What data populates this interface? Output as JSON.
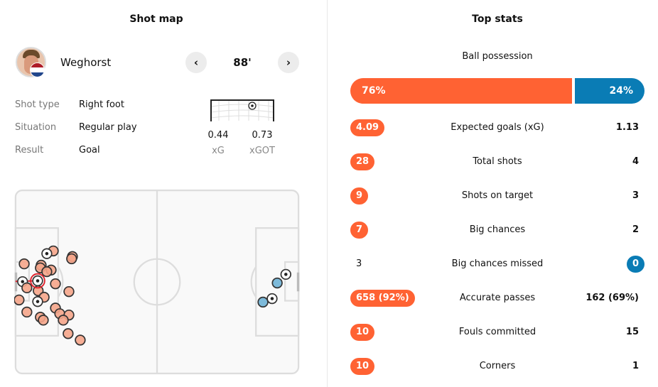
{
  "shot_map": {
    "title": "Shot map",
    "player": {
      "name": "Weghorst",
      "flag": [
        "#ae1c28",
        "#ffffff",
        "#21468b"
      ]
    },
    "minute": "88'",
    "prev_icon": "chevron-left-icon",
    "next_icon": "chevron-right-icon",
    "details": [
      {
        "label": "Shot type",
        "value": "Right foot"
      },
      {
        "label": "Situation",
        "value": "Regular play"
      },
      {
        "label": "Result",
        "value": "Goal"
      }
    ],
    "xg": {
      "value": "0.44",
      "label": "xG"
    },
    "xgot": {
      "value": "0.73",
      "label": "xGOT"
    },
    "colors": {
      "home_shot": "#f5a58a",
      "away_shot": "#6fb3d6",
      "selected": "#e0202a"
    },
    "shots_home": [
      {
        "x": 14.0,
        "y": 22.5,
        "goal": false
      },
      {
        "x": 11.6,
        "y": 23.5,
        "goal": true
      },
      {
        "x": 21.1,
        "y": 24.6,
        "goal": false
      },
      {
        "x": 20.8,
        "y": 25.4,
        "goal": false
      },
      {
        "x": 3.2,
        "y": 27.3,
        "goal": false
      },
      {
        "x": 9.5,
        "y": 27.8,
        "goal": false
      },
      {
        "x": 9.2,
        "y": 28.8,
        "goal": false
      },
      {
        "x": 13.2,
        "y": 29.6,
        "goal": false
      },
      {
        "x": 11.6,
        "y": 30.2,
        "goal": false
      },
      {
        "x": 2.6,
        "y": 33.9,
        "goal": true
      },
      {
        "x": 4.2,
        "y": 36.2,
        "goal": false
      },
      {
        "x": 14.8,
        "y": 34.7,
        "goal": false
      },
      {
        "x": 8.4,
        "y": 37.3,
        "goal": false
      },
      {
        "x": 10.6,
        "y": 39.7,
        "goal": false
      },
      {
        "x": 19.8,
        "y": 37.6,
        "goal": false
      },
      {
        "x": 1.3,
        "y": 40.7,
        "goal": false
      },
      {
        "x": 8.2,
        "y": 41.3,
        "goal": true
      },
      {
        "x": 14.8,
        "y": 43.7,
        "goal": false
      },
      {
        "x": 16.4,
        "y": 45.8,
        "goal": false
      },
      {
        "x": 19.8,
        "y": 46.3,
        "goal": false
      },
      {
        "x": 17.7,
        "y": 48.2,
        "goal": false
      },
      {
        "x": 4.2,
        "y": 45.2,
        "goal": false
      },
      {
        "x": 9.2,
        "y": 47.1,
        "goal": false
      },
      {
        "x": 10.3,
        "y": 48.2,
        "goal": false
      },
      {
        "x": 19.5,
        "y": 53.2,
        "goal": false
      },
      {
        "x": 24.0,
        "y": 55.6,
        "goal": false
      },
      {
        "x": 8.2,
        "y": 33.6,
        "goal": true,
        "selected": true
      }
    ],
    "shots_away": [
      {
        "x": 100.3,
        "y": 31.2,
        "goal": true
      },
      {
        "x": 97.1,
        "y": 34.4,
        "goal": false
      },
      {
        "x": 95.2,
        "y": 40.2,
        "goal": true
      },
      {
        "x": 91.8,
        "y": 41.5,
        "goal": false
      }
    ]
  },
  "top_stats": {
    "title": "Top stats",
    "possession": {
      "label": "Ball possession",
      "home": "76%",
      "away": "24%",
      "home_pct": 76
    },
    "colors": {
      "home": "#ff6233",
      "away": "#0a7cb5"
    },
    "rows": [
      {
        "label": "Expected goals (xG)",
        "home": "4.09",
        "away": "1.13",
        "highlight": "home"
      },
      {
        "label": "Total shots",
        "home": "28",
        "away": "4",
        "highlight": "home"
      },
      {
        "label": "Shots on target",
        "home": "9",
        "away": "3",
        "highlight": "home"
      },
      {
        "label": "Big chances",
        "home": "7",
        "away": "2",
        "highlight": "home"
      },
      {
        "label": "Big chances missed",
        "home": "3",
        "away": "0",
        "highlight": "away"
      },
      {
        "label": "Accurate passes",
        "home": "658 (92%)",
        "away": "162 (69%)",
        "highlight": "home"
      },
      {
        "label": "Fouls committed",
        "home": "10",
        "away": "15",
        "highlight": "home"
      },
      {
        "label": "Corners",
        "home": "10",
        "away": "1",
        "highlight": "home"
      }
    ]
  }
}
